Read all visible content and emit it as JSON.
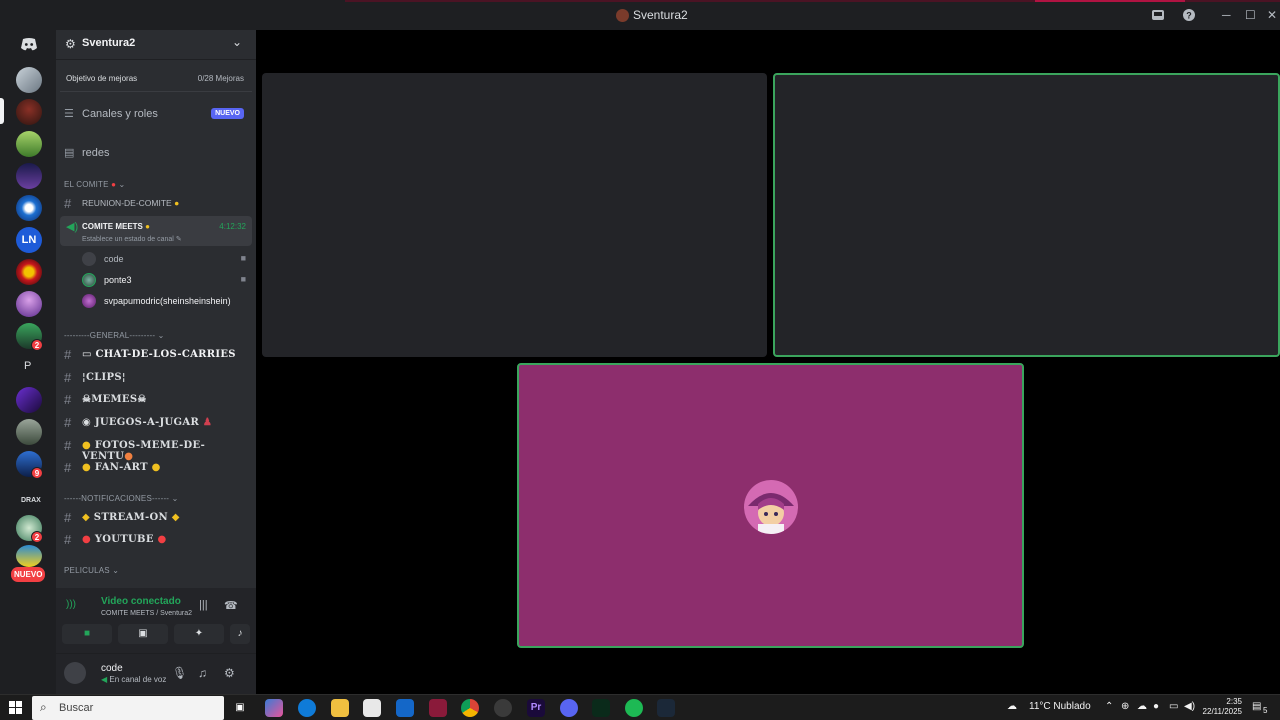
{
  "window": {
    "title": "Sventura2",
    "inbox_icon": "inbox-icon",
    "help_icon": "help-icon",
    "minimize": "─",
    "maximize": "☐",
    "close": "✕"
  },
  "rail": {
    "letter_server": "P",
    "drax_label": "DRAX",
    "badge_a": "2",
    "badge_b": "9",
    "badge_c": "2",
    "nuevo_label": "NUEVO"
  },
  "sidebar": {
    "guild_name": "Sventura2",
    "boost_label": "Objetivo de mejoras",
    "boost_progress": "0/28 Mejoras",
    "channels_roles": "Canales y roles",
    "new_badge": "NUEVO",
    "redes": "redes",
    "categories": {
      "comite": "EL COMITE",
      "general": "---------GENERAL---------",
      "notificaciones": "------NOTIFICACIONES------",
      "peliculas": "PELICULAS"
    },
    "reunion": "REUNION-DE-COMITE",
    "voice_channel": {
      "name": "COMITE MEETS",
      "timer": "4:12:32",
      "status": "Establece un estado de canal"
    },
    "voice_users": [
      {
        "name": "code"
      },
      {
        "name": "ponte3"
      },
      {
        "name": "svpapumodric(sheinsheinshein)"
      }
    ],
    "text_channels": [
      "CHAT-DE-LOS-CARRIES",
      "CLIPS",
      "MEMES",
      "JUEGOS-A-JUGAR",
      "FOTOS-MEME-DE-VENTU",
      "FAN-ART"
    ],
    "notif_channels": [
      "STREAM-ON",
      "YOUTUBE"
    ]
  },
  "voice_panel": {
    "title": "Video conectado",
    "subtitle": "COMITE MEETS / Sventura2"
  },
  "user_panel": {
    "name": "code",
    "status": "En canal de voz"
  },
  "taskbar": {
    "search_placeholder": "Buscar",
    "weather": "11°C Nublado",
    "time": "2:35",
    "date": "22/11/2025",
    "notif_count": "5"
  },
  "colors": {
    "accent_green": "#3ba55d",
    "tile_magenta": "#8d2e6d",
    "sidebar_bg": "#2b2d31",
    "rail_bg": "#1e1f22"
  }
}
